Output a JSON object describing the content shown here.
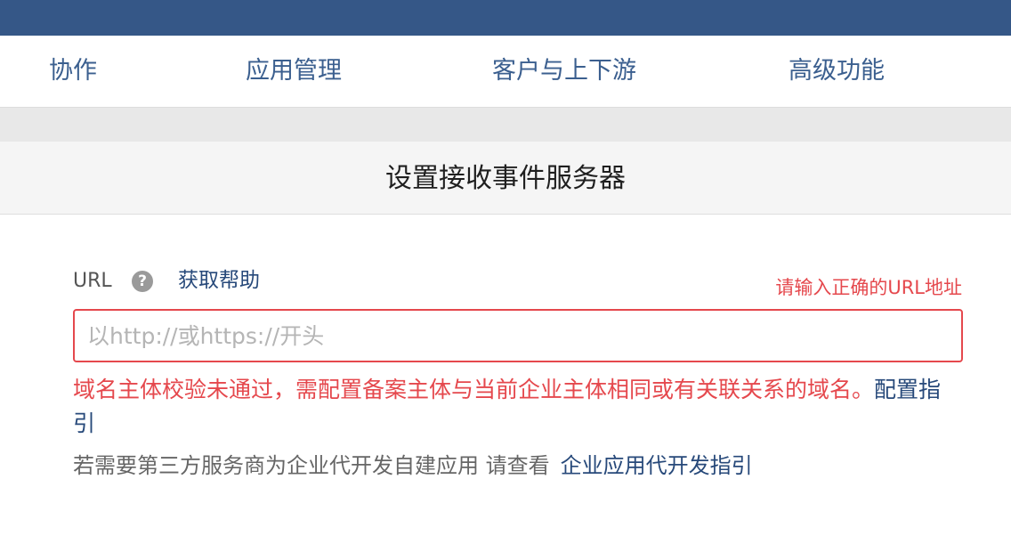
{
  "nav": {
    "tabs": [
      {
        "label": "协作"
      },
      {
        "label": "应用管理"
      },
      {
        "label": "客户与上下游"
      },
      {
        "label": "高级功能"
      }
    ]
  },
  "page": {
    "title": "设置接收事件服务器"
  },
  "form": {
    "url_label": "URL",
    "help_icon_glyph": "?",
    "help_link": "获取帮助",
    "field_error": "请输入正确的URL地址",
    "url_value": "",
    "url_placeholder": "以http://或https://开头",
    "error_message": "域名主体校验未通过，需配置备案主体与当前企业主体相同或有关联关系的域名。",
    "config_guide_link": "配置指引",
    "note_text": "若需要第三方服务商为企业代开发自建应用 请查看",
    "dev_guide_link": "企业应用代开发指引"
  },
  "colors": {
    "topbar": "#355787",
    "tab_text": "#3b5f8f",
    "error": "#e5484d",
    "link": "#27497a"
  },
  "icons": {
    "help": "question-circle-icon"
  }
}
